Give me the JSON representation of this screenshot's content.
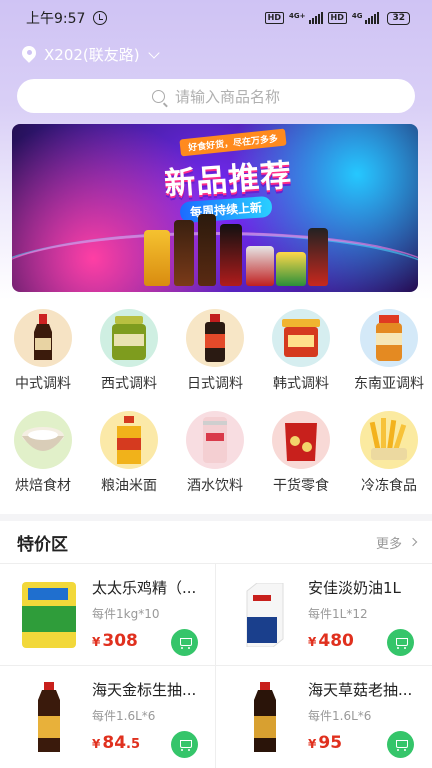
{
  "status_bar": {
    "time": "上午9:57",
    "hd1": "HD",
    "net1": "4G+",
    "hd2": "HD",
    "net2": "4G",
    "battery": "32"
  },
  "header": {
    "location": "X202(联友路)",
    "search_placeholder": "请输入商品名称"
  },
  "banner": {
    "tag": "好食好货，尽在万多多",
    "title": "新品推荐",
    "subtitle": "每周持续上新"
  },
  "categories": [
    {
      "label": "中式调料",
      "icon": "soy-sauce-icon",
      "bg": "#f6e3c4"
    },
    {
      "label": "西式调料",
      "icon": "pickle-jar-icon",
      "bg": "#cfefe2"
    },
    {
      "label": "日式调料",
      "icon": "sauce-bottle-icon",
      "bg": "#f7e6c6"
    },
    {
      "label": "韩式调料",
      "icon": "paste-tub-icon",
      "bg": "#d6eef0"
    },
    {
      "label": "东南亚调料",
      "icon": "jar-icon",
      "bg": "#d4e9f8"
    },
    {
      "label": "烘焙食材",
      "icon": "flour-bowl-icon",
      "bg": "#e1f0c9"
    },
    {
      "label": "粮油米面",
      "icon": "oil-bottle-icon",
      "bg": "#fbe9a8"
    },
    {
      "label": "酒水饮料",
      "icon": "drink-can-icon",
      "bg": "#f8dde1"
    },
    {
      "label": "干货零食",
      "icon": "snack-bag-icon",
      "bg": "#f8d9d6"
    },
    {
      "label": "冷冻食品",
      "icon": "fries-icon",
      "bg": "#fbeaa0"
    }
  ],
  "special": {
    "title": "特价区",
    "more": "更多"
  },
  "products": [
    {
      "name": "太太乐鸡精（...",
      "spec": "每件1kg*10",
      "currency": "¥",
      "price_int": "308",
      "price_dec": ""
    },
    {
      "name": "安佳淡奶油1L",
      "spec": "每件1L*12",
      "currency": "¥",
      "price_int": "480",
      "price_dec": ""
    },
    {
      "name": "海天金标生抽...",
      "spec": "每件1.6L*6",
      "currency": "¥",
      "price_int": "84",
      "price_dec": ".5"
    },
    {
      "name": "海天草菇老抽...",
      "spec": "每件1.6L*6",
      "currency": "¥",
      "price_int": "95",
      "price_dec": ""
    }
  ],
  "colors": {
    "accent_green": "#35c56a",
    "price_red": "#e0301e",
    "header_purple": "#cfc3f4"
  }
}
